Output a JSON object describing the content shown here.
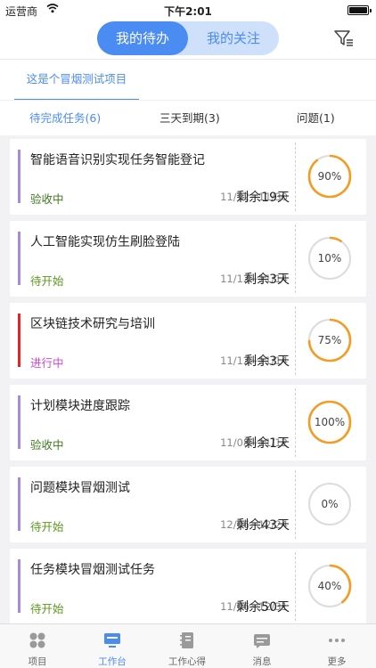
{
  "status_bar": {
    "carrier": "运营商",
    "time": "下午2:01"
  },
  "header": {
    "tab_active": "我的待办",
    "tab_inactive": "我的关注",
    "filter_icon": "filter-list-icon"
  },
  "project_tab": "这是个冒烟测试项目",
  "filter_tabs": [
    {
      "label": "待完成任务(6)",
      "active": true
    },
    {
      "label": "三天到期(3)",
      "active": false
    },
    {
      "label": "问题(1)",
      "active": false
    }
  ],
  "colors": {
    "accent": "#4b8cf2",
    "ring_progress": "#f39b22",
    "ring_track": "#dcdcdc",
    "bar_normal": "#a98ad9",
    "bar_urgent": "#e52525",
    "status_acceptance": "#3d7a1e",
    "status_pending": "#5a9a1c",
    "status_in_progress": "#d644d6"
  },
  "tasks": [
    {
      "title": "智能语音识别实现任务智能登记",
      "status": "验收中",
      "status_color": "#3d7a1e",
      "bar_color": "#a98ad9",
      "dates": "11/12~11/30",
      "remaining": "剩余19天",
      "progress": 90,
      "progress_label": "90%"
    },
    {
      "title": "人工智能实现仿生刷脸登陆",
      "status": "待开始",
      "status_color": "#5a9a1c",
      "bar_color": "#a98ad9",
      "dates": "11/12~11/14",
      "remaining": "剩余3天",
      "progress": 10,
      "progress_label": "10%"
    },
    {
      "title": "区块链技术研究与培训",
      "status": "进行中",
      "status_color": "#d644d6",
      "bar_color": "#e52525",
      "dates": "11/12~11/14",
      "remaining": "剩余3天",
      "progress": 75,
      "progress_label": "75%"
    },
    {
      "title": "计划模块进度跟踪",
      "status": "验收中",
      "status_color": "#3d7a1e",
      "bar_color": "#a98ad9",
      "dates": "11/08~11/12",
      "remaining": "剩余1天",
      "progress": 100,
      "progress_label": "100%"
    },
    {
      "title": "问题模块冒烟测试",
      "status": "待开始",
      "status_color": "#5a9a1c",
      "bar_color": "#a98ad9",
      "dates": "12/06~12/24",
      "remaining": "剩余43天",
      "progress": 0,
      "progress_label": "0%"
    },
    {
      "title": "任务模块冒烟测试任务",
      "status": "待开始",
      "status_color": "#5a9a1c",
      "bar_color": "#a98ad9",
      "dates": "11/06~12/31",
      "remaining": "剩余50天",
      "progress": 40,
      "progress_label": "40%"
    }
  ],
  "tab_bar": [
    {
      "label": "项目",
      "icon": "grid-icon",
      "active": false
    },
    {
      "label": "工作台",
      "icon": "monitor-icon",
      "active": true
    },
    {
      "label": "工作心得",
      "icon": "notebook-icon",
      "active": false
    },
    {
      "label": "消息",
      "icon": "message-icon",
      "active": false
    },
    {
      "label": "更多",
      "icon": "more-dots-icon",
      "active": false
    }
  ]
}
